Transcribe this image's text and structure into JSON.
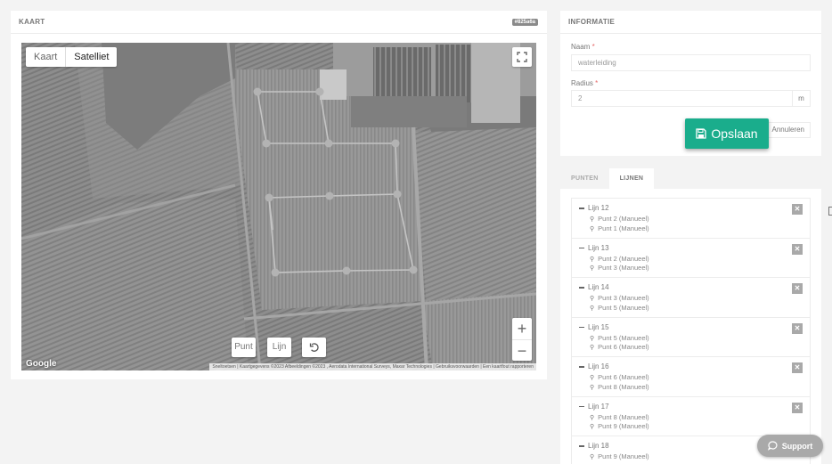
{
  "map_panel": {
    "title": "KAART",
    "badge": "#825a6a",
    "map_type": {
      "options": [
        "Kaart",
        "Satelliet"
      ],
      "active": "Satelliet"
    },
    "tools": {
      "point": "Punt",
      "line": "Lijn",
      "undo_icon": "undo-icon"
    },
    "zoom": {
      "in": "+",
      "out": "−"
    },
    "google_logo": "Google",
    "attribution": "Sneltoetsen  |  Kaartgegevens ©2023 Afbeeldingen ©2023 , Aerodata International Surveys, Maxar Technologies  |  Gebruiksvoorwaarden  |  Een kaartfout rapporteren"
  },
  "info": {
    "title": "INFORMATIE",
    "name_label": "Naam",
    "name_value": "waterleiding",
    "radius_label": "Radius",
    "radius_value": "2",
    "radius_unit": "m",
    "required_mark": "*",
    "save_label": "Opslaan",
    "cancel_label": "Annuleren"
  },
  "tabs": {
    "points": "PUNTEN",
    "lines": "LIJNEN",
    "active": "LIJNEN"
  },
  "lines": [
    {
      "name": "Lijn 12",
      "points": [
        "Punt 2 (Manueel)",
        "Punt 1 (Manueel)"
      ]
    },
    {
      "name": "Lijn 13",
      "points": [
        "Punt 2 (Manueel)",
        "Punt 3 (Manueel)"
      ]
    },
    {
      "name": "Lijn 14",
      "points": [
        "Punt 3 (Manueel)",
        "Punt 5 (Manueel)"
      ]
    },
    {
      "name": "Lijn 15",
      "points": [
        "Punt 5 (Manueel)",
        "Punt 6 (Manueel)"
      ]
    },
    {
      "name": "Lijn 16",
      "points": [
        "Punt 6 (Manueel)",
        "Punt 8 (Manueel)"
      ]
    },
    {
      "name": "Lijn 17",
      "points": [
        "Punt 8 (Manueel)",
        "Punt 9 (Manueel)"
      ]
    },
    {
      "name": "Lijn 18",
      "points": [
        "Punt 9 (Manueel)"
      ]
    }
  ],
  "support_label": "Support"
}
